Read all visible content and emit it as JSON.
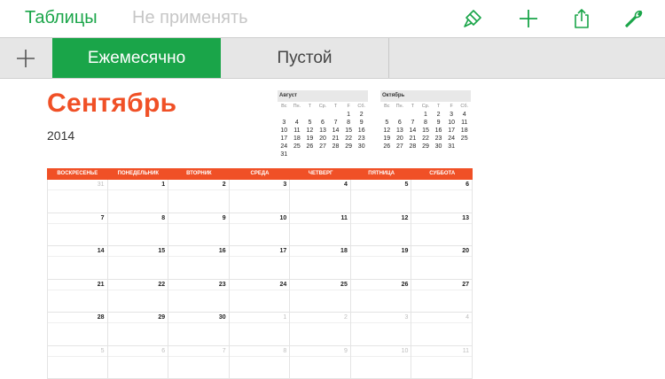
{
  "toolbar": {
    "back_label": "Таблицы",
    "undo_label": "Не применять",
    "icons": [
      "paintbrush-icon",
      "plus-icon",
      "share-icon",
      "wrench-icon"
    ],
    "accent_color": "#1aa549"
  },
  "tabs": [
    {
      "label": "Ежемесячно",
      "active": true
    },
    {
      "label": "Пустой",
      "active": false
    }
  ],
  "sheet": {
    "month_title": "Сентябрь",
    "year": "2014",
    "accent_color": "#f05026"
  },
  "mini_calendars": [
    {
      "title": "Август",
      "weekdays": [
        "Вс",
        "Пн.",
        "Т",
        "Ср.",
        "Т",
        "F",
        "Сб."
      ],
      "days": [
        "",
        "",
        "",
        "",
        "",
        "1",
        "2",
        "3",
        "4",
        "5",
        "6",
        "7",
        "8",
        "9",
        "10",
        "11",
        "12",
        "13",
        "14",
        "15",
        "16",
        "17",
        "18",
        "19",
        "20",
        "21",
        "22",
        "23",
        "24",
        "25",
        "26",
        "27",
        "28",
        "29",
        "30",
        "31"
      ]
    },
    {
      "title": "Октябрь",
      "weekdays": [
        "Вс",
        "Пн.",
        "Т",
        "Ср.",
        "Т",
        "F",
        "Сб."
      ],
      "days": [
        "",
        "",
        "",
        "1",
        "2",
        "3",
        "4",
        "5",
        "6",
        "7",
        "8",
        "9",
        "10",
        "11",
        "12",
        "13",
        "14",
        "15",
        "16",
        "17",
        "18",
        "19",
        "20",
        "21",
        "22",
        "23",
        "24",
        "25",
        "26",
        "27",
        "28",
        "29",
        "30",
        "31"
      ]
    }
  ],
  "calendar": {
    "weekdays": [
      "ВОСКРЕСЕНЬЕ",
      "ПОНЕДЕЛЬНИК",
      "ВТОРНИК",
      "СРЕДА",
      "ЧЕТВЕРГ",
      "ПЯТНИЦА",
      "СУББОТА"
    ],
    "weeks": [
      [
        {
          "d": "31",
          "o": true
        },
        {
          "d": "1"
        },
        {
          "d": "2"
        },
        {
          "d": "3"
        },
        {
          "d": "4"
        },
        {
          "d": "5"
        },
        {
          "d": "6"
        }
      ],
      [
        {
          "d": "7"
        },
        {
          "d": "8"
        },
        {
          "d": "9"
        },
        {
          "d": "10"
        },
        {
          "d": "11"
        },
        {
          "d": "12"
        },
        {
          "d": "13"
        }
      ],
      [
        {
          "d": "14"
        },
        {
          "d": "15"
        },
        {
          "d": "16"
        },
        {
          "d": "17"
        },
        {
          "d": "18"
        },
        {
          "d": "19"
        },
        {
          "d": "20"
        }
      ],
      [
        {
          "d": "21"
        },
        {
          "d": "22"
        },
        {
          "d": "23"
        },
        {
          "d": "24"
        },
        {
          "d": "25"
        },
        {
          "d": "26"
        },
        {
          "d": "27"
        }
      ],
      [
        {
          "d": "28"
        },
        {
          "d": "29"
        },
        {
          "d": "30"
        },
        {
          "d": "1",
          "o": true
        },
        {
          "d": "2",
          "o": true
        },
        {
          "d": "3",
          "o": true
        },
        {
          "d": "4",
          "o": true
        }
      ],
      [
        {
          "d": "5",
          "o": true
        },
        {
          "d": "6",
          "o": true
        },
        {
          "d": "7",
          "o": true
        },
        {
          "d": "8",
          "o": true
        },
        {
          "d": "9",
          "o": true
        },
        {
          "d": "10",
          "o": true
        },
        {
          "d": "11",
          "o": true
        }
      ]
    ]
  }
}
